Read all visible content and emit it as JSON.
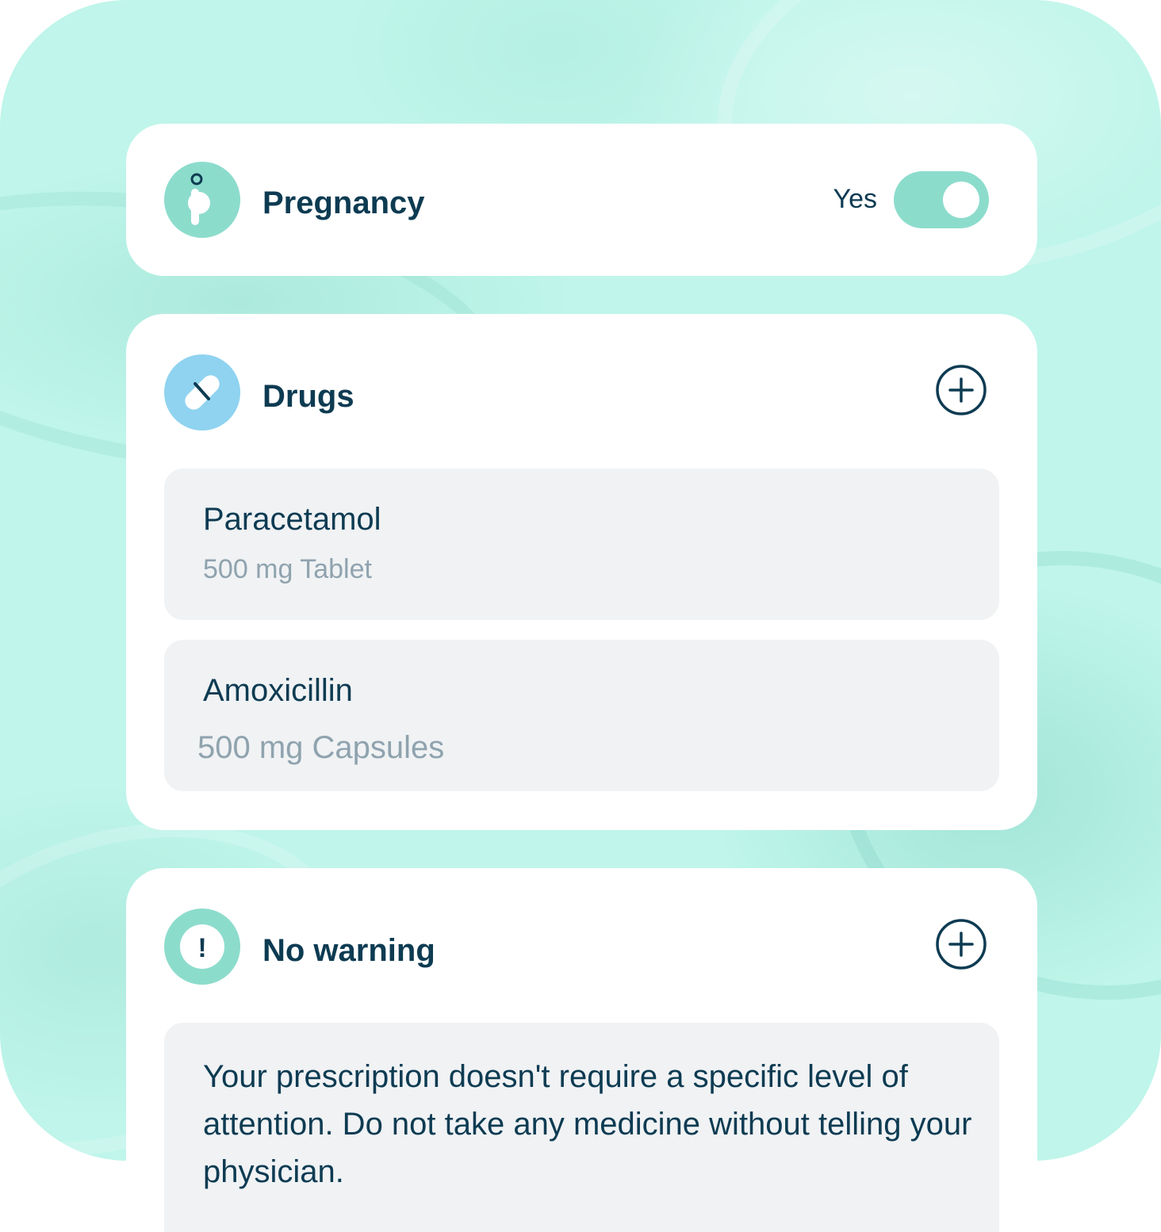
{
  "pregnancy": {
    "title": "Pregnancy",
    "toggle_label": "Yes",
    "toggle_on": true,
    "icon": "pregnancy-icon"
  },
  "drugs": {
    "title": "Drugs",
    "icon": "pill-icon",
    "add_icon": "plus-circle-icon",
    "items": [
      {
        "name": "Paracetamol",
        "dose": "500 mg Tablet"
      },
      {
        "name": "Amoxicillin",
        "dose": "500 mg Capsules"
      }
    ]
  },
  "warning": {
    "title": "No warning",
    "icon": "exclamation-icon",
    "add_icon": "plus-circle-icon",
    "message": "Your prescription doesn't require a specific level of attention. Do not take any medicine without telling your physician."
  },
  "colors": {
    "background": "#bff5ea",
    "accent_teal": "#8cdccc",
    "accent_blue": "#8fd3f0",
    "text_primary": "#0d3b52",
    "text_secondary": "#8fa3ae",
    "item_background": "#f0f2f4"
  }
}
